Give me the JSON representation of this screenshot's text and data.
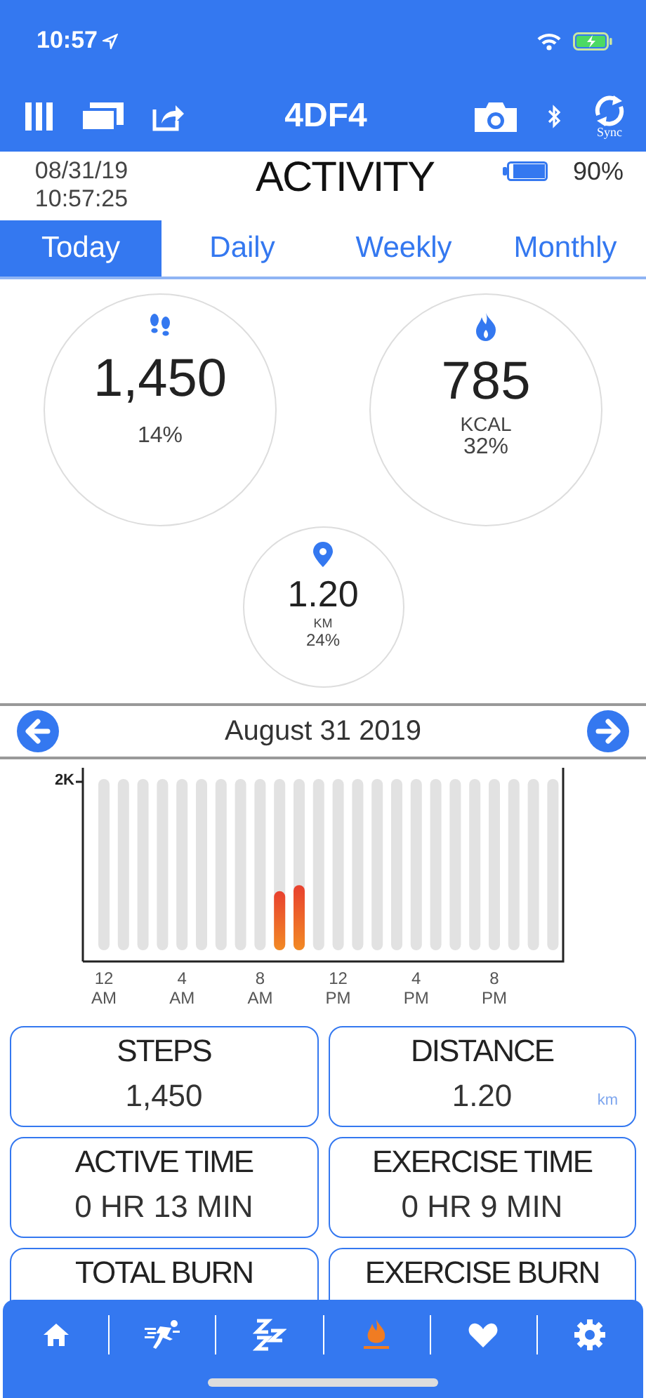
{
  "status_bar": {
    "time": "10:57"
  },
  "header": {
    "title": "4DF4",
    "sync_label": "Sync"
  },
  "info": {
    "date": "08/31/19",
    "time": "10:57:25",
    "title": "ACTIVITY",
    "battery": {
      "level": 0.9,
      "reading": "90%"
    }
  },
  "tabs": [
    {
      "label": "Today",
      "selected": true
    },
    {
      "label": "Daily",
      "selected": false
    },
    {
      "label": "Weekly",
      "selected": false
    },
    {
      "label": "Monthly",
      "selected": false
    }
  ],
  "circles": [
    {
      "kind": "steps",
      "value": "1,450",
      "percent": "14%"
    },
    {
      "kind": "calories",
      "value": "785",
      "unit": "KCAL",
      "percent": "32%"
    },
    {
      "kind": "distance",
      "value": "1.20",
      "unit": "KM",
      "percent": "24%"
    }
  ],
  "date_nav": {
    "date": "August 31 2019"
  },
  "chart": {
    "y_label": "2K",
    "x_labels": [
      "12 AM",
      "4 AM",
      "8 AM",
      "12 PM",
      "4 PM",
      "8 PM"
    ]
  },
  "cards": [
    {
      "title": "STEPS",
      "value": "1,450"
    },
    {
      "title": "DISTANCE",
      "value": "1.20",
      "unit": "km"
    },
    {
      "title": "ACTIVE TIME",
      "value": "0 HR 13 MIN"
    },
    {
      "title": "EXERCISE TIME",
      "value": "0 HR 9 MIN"
    },
    {
      "title": "TOTAL BURN"
    },
    {
      "title": "EXERCISE BURN"
    }
  ],
  "bottom_nav": [
    {
      "kind": "home",
      "selected": false
    },
    {
      "kind": "activity",
      "selected": false
    },
    {
      "kind": "sleep",
      "selected": false
    },
    {
      "kind": "burn",
      "selected": true
    },
    {
      "kind": "heart",
      "selected": false
    },
    {
      "kind": "settings",
      "selected": false
    }
  ]
}
